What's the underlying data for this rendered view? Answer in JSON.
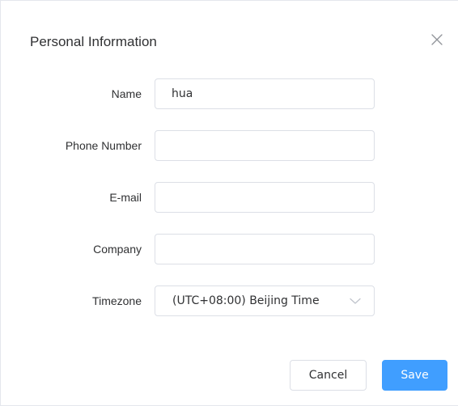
{
  "dialog": {
    "title": "Personal Information",
    "close_icon": "close-icon"
  },
  "form": {
    "name": {
      "label": "Name",
      "value": "hua"
    },
    "phone": {
      "label": "Phone Number",
      "value": ""
    },
    "email": {
      "label": "E-mail",
      "value": ""
    },
    "company": {
      "label": "Company",
      "value": ""
    },
    "timezone": {
      "label": "Timezone",
      "selected": "(UTC+08:00) Beijing Time",
      "icon": "chevron-down-icon"
    }
  },
  "footer": {
    "cancel_label": "Cancel",
    "save_label": "Save"
  },
  "colors": {
    "primary": "#409eff",
    "border": "#dcdfe6",
    "text": "#303133",
    "icon": "#909399"
  }
}
